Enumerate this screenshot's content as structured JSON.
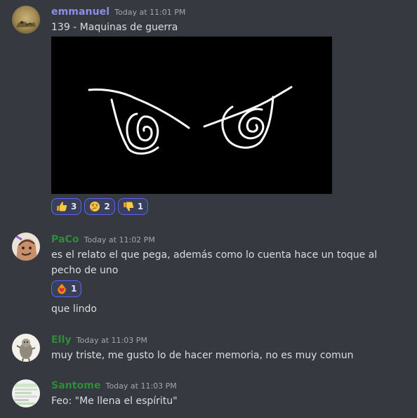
{
  "messages": [
    {
      "username": "emmanuel",
      "username_color": "#8c8fe8",
      "timestamp": "Today at 11:01 PM",
      "text": "139 - Maquinas de guerra",
      "reactions": [
        {
          "emoji": "thumbs-up",
          "count": "3"
        },
        {
          "emoji": "thinking-face",
          "count": "2"
        },
        {
          "emoji": "thumbs-down",
          "count": "1"
        }
      ]
    },
    {
      "username": "PaCo",
      "username_color": "#2d8d3a",
      "timestamp": "Today at 11:02 PM",
      "text": "es el relato el que pega, además como lo cuenta hace un toque al pecho de uno",
      "reactions": [
        {
          "emoji": "heart-on-fire",
          "count": "1"
        }
      ],
      "followup_text": "que lindo"
    },
    {
      "username": "Elly",
      "username_color": "#2d8d3a",
      "timestamp": "Today at 11:03 PM",
      "text": "muy triste, me gusto lo de hacer memoria, no es muy comun"
    },
    {
      "username": "Santome",
      "username_color": "#2d8d3a",
      "timestamp": "Today at 11:03 PM",
      "text": "Feo: \"Me llena el espíritu\""
    }
  ]
}
